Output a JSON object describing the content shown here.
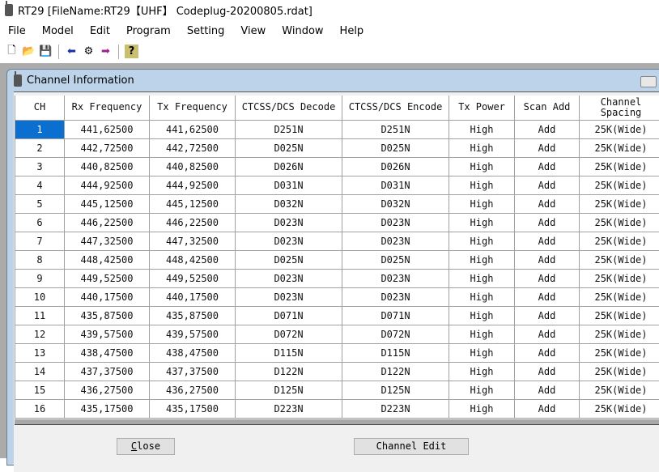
{
  "window": {
    "title": "RT29 [FileName:RT29【UHF】 Codeplug-20200805.rdat]"
  },
  "menu": [
    "File",
    "Model",
    "Edit",
    "Program",
    "Setting",
    "View",
    "Window",
    "Help"
  ],
  "toolbar": [
    {
      "icon": "new-file-icon",
      "glyph": "🗋"
    },
    {
      "icon": "open-folder-icon",
      "glyph": "📂"
    },
    {
      "icon": "save-icon",
      "glyph": "💾"
    },
    {
      "icon": "read-arrow-icon",
      "glyph": "⬅"
    },
    {
      "icon": "radio-settings-icon",
      "glyph": "⚙"
    },
    {
      "icon": "write-arrow-icon",
      "glyph": "➡"
    },
    {
      "icon": "help-icon",
      "glyph": "?"
    }
  ],
  "child": {
    "title": "Channel Information"
  },
  "table": {
    "headers": [
      "CH",
      "Rx Frequency",
      "Tx Frequency",
      "CTCSS/DCS Decode",
      "CTCSS/DCS Encode",
      "Tx Power",
      "Scan Add",
      "Channel Spacing"
    ],
    "rows": [
      [
        "1",
        "441,62500",
        "441,62500",
        "D251N",
        "D251N",
        "High",
        "Add",
        "25K(Wide)"
      ],
      [
        "2",
        "442,72500",
        "442,72500",
        "D025N",
        "D025N",
        "High",
        "Add",
        "25K(Wide)"
      ],
      [
        "3",
        "440,82500",
        "440,82500",
        "D026N",
        "D026N",
        "High",
        "Add",
        "25K(Wide)"
      ],
      [
        "4",
        "444,92500",
        "444,92500",
        "D031N",
        "D031N",
        "High",
        "Add",
        "25K(Wide)"
      ],
      [
        "5",
        "445,12500",
        "445,12500",
        "D032N",
        "D032N",
        "High",
        "Add",
        "25K(Wide)"
      ],
      [
        "6",
        "446,22500",
        "446,22500",
        "D023N",
        "D023N",
        "High",
        "Add",
        "25K(Wide)"
      ],
      [
        "7",
        "447,32500",
        "447,32500",
        "D023N",
        "D023N",
        "High",
        "Add",
        "25K(Wide)"
      ],
      [
        "8",
        "448,42500",
        "448,42500",
        "D025N",
        "D025N",
        "High",
        "Add",
        "25K(Wide)"
      ],
      [
        "9",
        "449,52500",
        "449,52500",
        "D023N",
        "D023N",
        "High",
        "Add",
        "25K(Wide)"
      ],
      [
        "10",
        "440,17500",
        "440,17500",
        "D023N",
        "D023N",
        "High",
        "Add",
        "25K(Wide)"
      ],
      [
        "11",
        "435,87500",
        "435,87500",
        "D071N",
        "D071N",
        "High",
        "Add",
        "25K(Wide)"
      ],
      [
        "12",
        "439,57500",
        "439,57500",
        "D072N",
        "D072N",
        "High",
        "Add",
        "25K(Wide)"
      ],
      [
        "13",
        "438,47500",
        "438,47500",
        "D115N",
        "D115N",
        "High",
        "Add",
        "25K(Wide)"
      ],
      [
        "14",
        "437,37500",
        "437,37500",
        "D122N",
        "D122N",
        "High",
        "Add",
        "25K(Wide)"
      ],
      [
        "15",
        "436,27500",
        "436,27500",
        "D125N",
        "D125N",
        "High",
        "Add",
        "25K(Wide)"
      ],
      [
        "16",
        "435,17500",
        "435,17500",
        "D223N",
        "D223N",
        "High",
        "Add",
        "25K(Wide)"
      ]
    ]
  },
  "buttons": {
    "close": "Close",
    "channel_edit": "Channel Edit"
  }
}
